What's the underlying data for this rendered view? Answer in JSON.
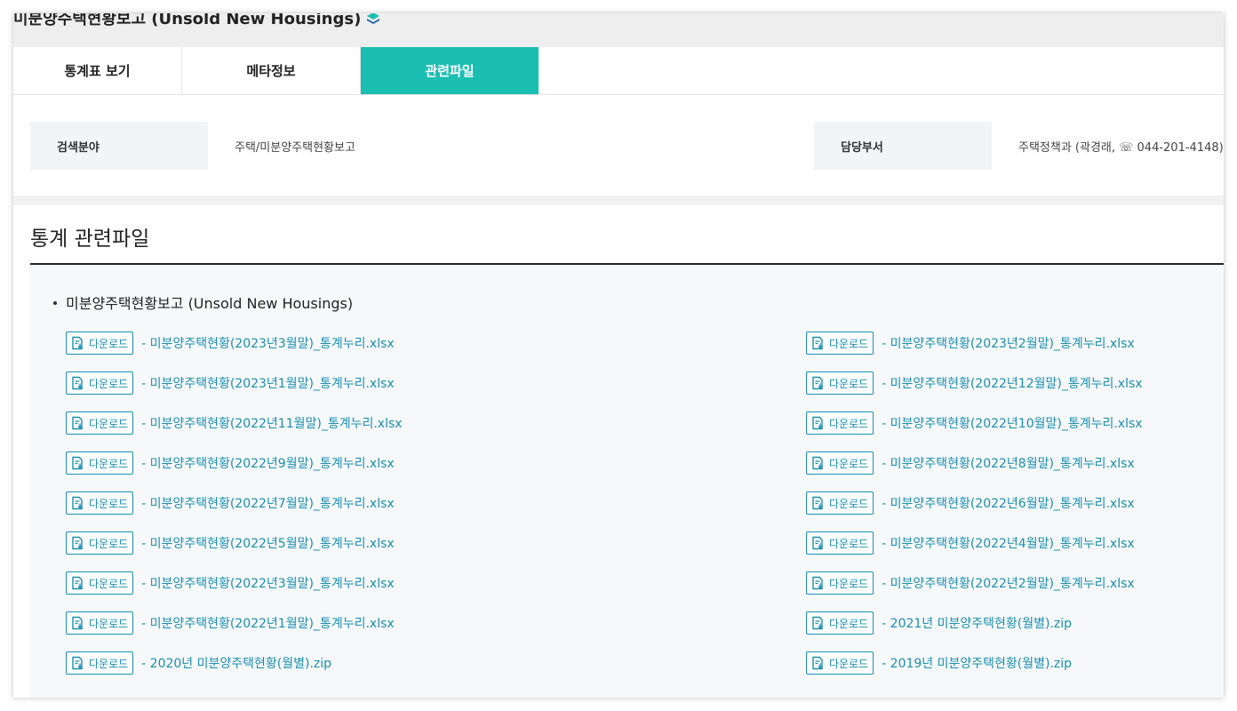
{
  "header": {
    "title": "미분양주택현황보고 (Unsold New Housings)"
  },
  "tabs": [
    {
      "label": "통계표 보기",
      "active": false
    },
    {
      "label": "메타정보",
      "active": false
    },
    {
      "label": "관련파일",
      "active": true
    }
  ],
  "meta": {
    "field_label": "검색분야",
    "field_value": "주택/미분양주택현황보고",
    "dept_label": "담당부서",
    "dept_value": "주택정책과 (곽경래, ☏ 044-201-4148)"
  },
  "files_section": {
    "heading": "통계 관련파일",
    "group_title": "미분양주택현황보고 (Unsold New Housings)",
    "download_label": "다운로드",
    "files": [
      "- 미분양주택현황(2023년3월말)_통계누리.xlsx",
      "- 미분양주택현황(2023년2월말)_통계누리.xlsx",
      "- 미분양주택현황(2023년1월말)_통계누리.xlsx",
      "- 미분양주택현황(2022년12월말)_통계누리.xlsx",
      "- 미분양주택현황(2022년11월말)_통계누리.xlsx",
      "- 미분양주택현황(2022년10월말)_통계누리.xlsx",
      "- 미분양주택현황(2022년9월말)_통계누리.xlsx",
      "- 미분양주택현황(2022년8월말)_통계누리.xlsx",
      "- 미분양주택현황(2022년7월말)_통계누리.xlsx",
      "- 미분양주택현황(2022년6월말)_통계누리.xlsx",
      "- 미분양주택현황(2022년5월말)_통계누리.xlsx",
      "- 미분양주택현황(2022년4월말)_통계누리.xlsx",
      "- 미분양주택현황(2022년3월말)_통계누리.xlsx",
      "- 미분양주택현황(2022년2월말)_통계누리.xlsx",
      "- 미분양주택현황(2022년1월말)_통계누리.xlsx",
      "- 2021년 미분양주택현황(월별).zip",
      "- 2020년 미분양주택현황(월별).zip",
      "- 2019년 미분양주택현황(월별).zip"
    ]
  },
  "colors": {
    "accent": "#1bbfb2",
    "link": "#1a8fb0"
  }
}
